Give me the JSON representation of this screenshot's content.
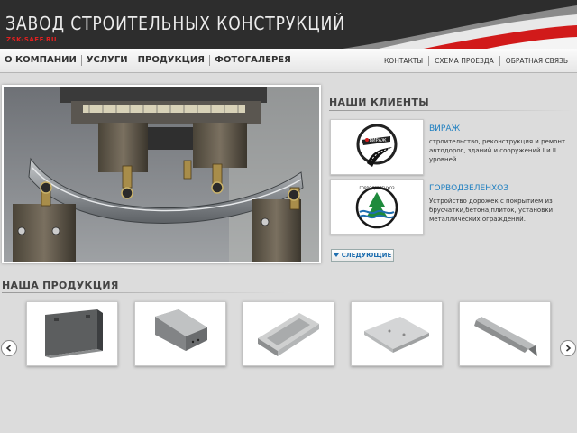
{
  "header": {
    "title": "ЗАВОД СТРОИТЕЛЬНЫХ КОНСТРУКЦИЙ",
    "domain": "ZSK-SAFF.RU"
  },
  "nav": {
    "main": [
      "О КОМПАНИИ",
      "УСЛУГИ",
      "ПРОДУКЦИЯ",
      "ФОТОГАЛЕРЕЯ"
    ],
    "secondary": [
      "КОНТАКТЫ",
      "СХЕМА ПРОЕЗДА",
      "ОБРАТНАЯ СВЯЗЬ"
    ]
  },
  "clients": {
    "title": "НАШИ КЛИЕНТЫ",
    "items": [
      {
        "name": "ВИРАЖ",
        "logo_text": "ВИРАЖ",
        "description": "строительство, реконструкция и ремонт автодорог, зданий и сооружений I и II уровней"
      },
      {
        "name": "ГОРВОДЗЕЛЕНХОЗ",
        "logo_text": "ГОРВОДЗЕЛЕНХОЗ",
        "description": "Устройство дорожек с покрытием из брусчатки,бетона,плиток, установки металлических ограждений."
      }
    ],
    "next_label": "СЛЕДУЮЩИЕ"
  },
  "products": {
    "title": "НАША ПРОДУКЦИЯ",
    "items": [
      "wall-panel",
      "concrete-column",
      "concrete-tray",
      "road-slab",
      "concrete-pile"
    ]
  },
  "colors": {
    "accent_red": "#e02020",
    "link_blue": "#1f7fc0",
    "header_dark": "#2d2d2d",
    "background": "#dcdcdc"
  }
}
